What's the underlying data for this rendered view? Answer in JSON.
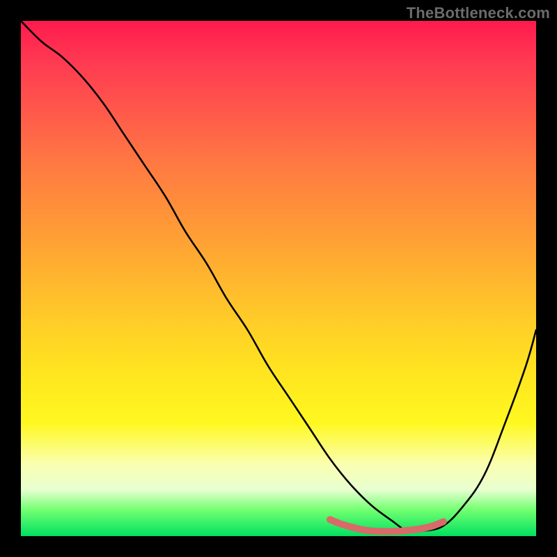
{
  "watermark": "TheBottleneck.com",
  "colors": {
    "background": "#000000",
    "curve_stroke": "#000000",
    "bottom_marker": "#d96a6a"
  },
  "chart_data": {
    "type": "line",
    "title": "",
    "xlabel": "",
    "ylabel": "",
    "xlim": [
      0,
      100
    ],
    "ylim": [
      0,
      100
    ],
    "series": [
      {
        "name": "bottleneck-curve",
        "x": [
          0,
          4,
          8,
          12,
          16,
          20,
          24,
          28,
          32,
          36,
          40,
          44,
          48,
          52,
          56,
          60,
          64,
          68,
          72,
          75,
          78,
          82,
          86,
          90,
          94,
          98,
          100
        ],
        "y": [
          100,
          96,
          93,
          89,
          84,
          78,
          72,
          66,
          59,
          53,
          46,
          40,
          33,
          27,
          21,
          15,
          10,
          6,
          3,
          1,
          1,
          2,
          6,
          12,
          22,
          33,
          40
        ]
      }
    ],
    "bottom_marker": {
      "x": [
        60,
        62,
        64,
        66,
        68,
        70,
        72,
        74,
        76,
        78,
        80,
        82
      ],
      "y": [
        3.2,
        2.4,
        1.8,
        1.3,
        1.0,
        0.9,
        0.9,
        1.0,
        1.2,
        1.5,
        2.0,
        2.8
      ]
    }
  }
}
